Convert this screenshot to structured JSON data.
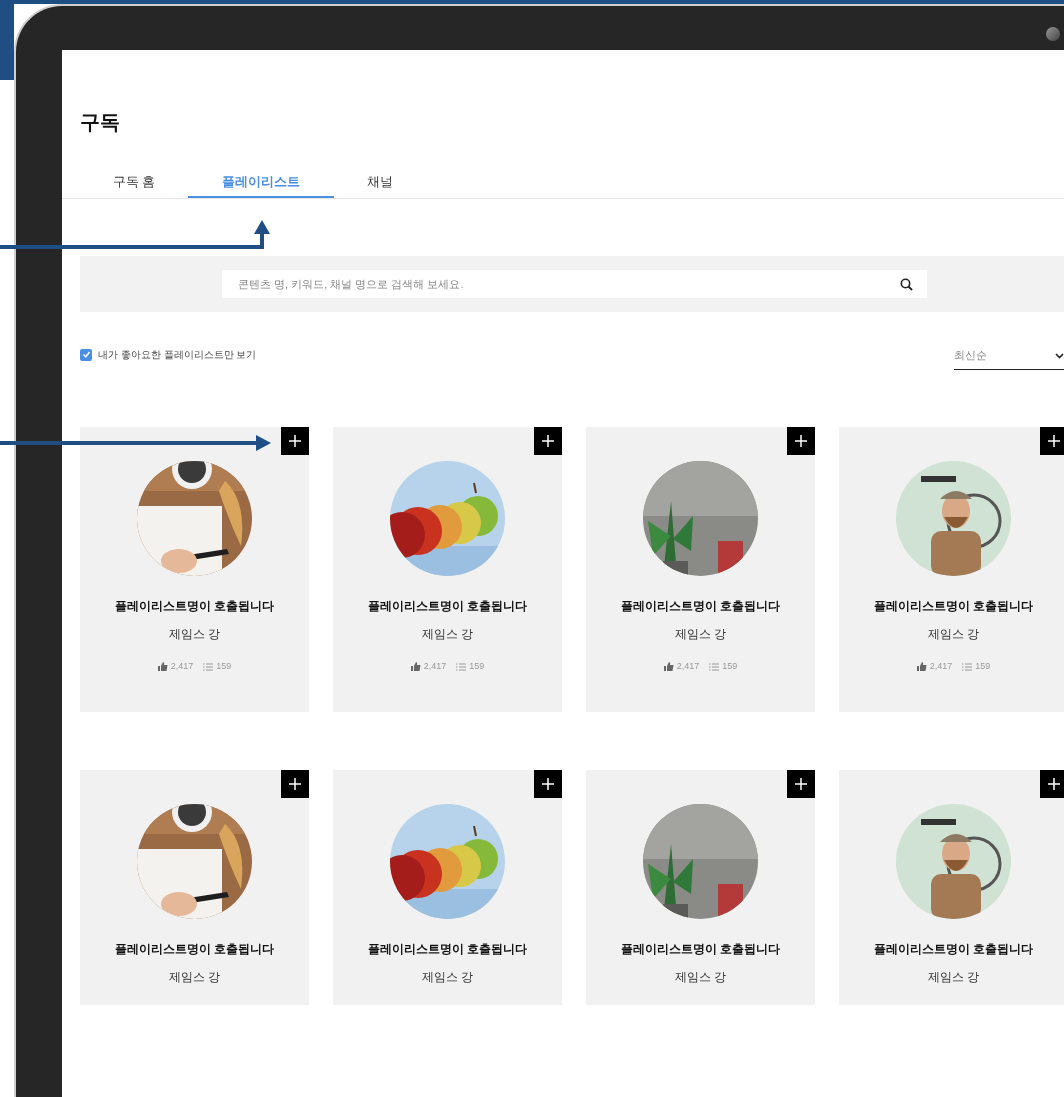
{
  "page": {
    "title": "구독"
  },
  "tabs": [
    {
      "label": "구독 홈",
      "selected": false
    },
    {
      "label": "플레이리스트",
      "selected": true
    },
    {
      "label": "채널",
      "selected": false
    }
  ],
  "search": {
    "placeholder": "콘텐츠 명, 키워드, 채널 명으로 검색해 보세요."
  },
  "filter": {
    "label": "내가 좋아요한 플레이리스트만 보기",
    "checked": true
  },
  "sort": {
    "value": "최신순"
  },
  "playlists": [
    {
      "kind": "picture",
      "title": "플레이리스트명이 호출됩니다",
      "author": "제임스 강",
      "likes": "2,417",
      "tracks": "159"
    },
    {
      "kind": "picture",
      "title": "플레이리스트명이 호출됩니다",
      "author": "제임스 강",
      "likes": "2,417",
      "tracks": "159"
    },
    {
      "kind": "picture",
      "title": "플레이리스트명이 호출됩니다",
      "author": "제임스 강",
      "likes": "2,417",
      "tracks": "159"
    },
    {
      "kind": "picture",
      "title": "플레이리스트명이 호출됩니다",
      "author": "제임스 강",
      "likes": "2,417",
      "tracks": "159"
    },
    {
      "kind": "picture",
      "title": "플레이리스트명이 호출됩니다",
      "author": "제임스 강"
    },
    {
      "kind": "picture",
      "title": "플레이리스트명이 호출됩니다",
      "author": "제임스 강"
    },
    {
      "kind": "picture",
      "title": "플레이리스트명이 호출됩니다",
      "author": "제임스 강"
    },
    {
      "kind": "picture",
      "title": "플레이리스트명이 호출됩니다",
      "author": "제임스 강"
    }
  ]
}
